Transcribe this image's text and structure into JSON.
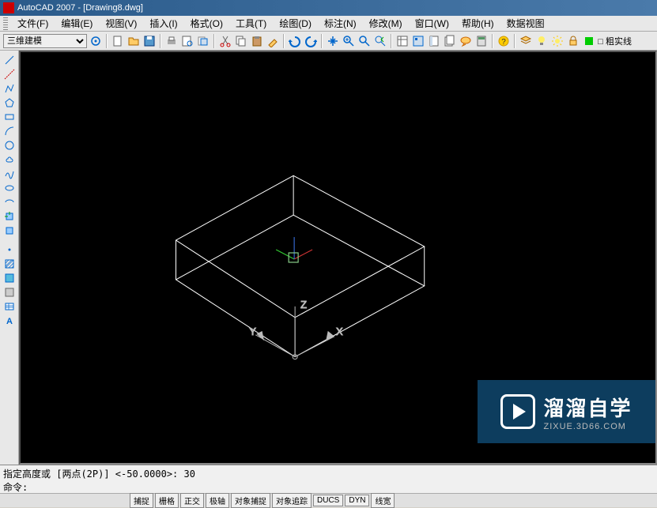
{
  "titlebar": {
    "title": "AutoCAD 2007 - [Drawing8.dwg]"
  },
  "menubar": {
    "items": [
      {
        "label": "文件(F)"
      },
      {
        "label": "编辑(E)"
      },
      {
        "label": "视图(V)"
      },
      {
        "label": "插入(I)"
      },
      {
        "label": "格式(O)"
      },
      {
        "label": "工具(T)"
      },
      {
        "label": "绘图(D)"
      },
      {
        "label": "标注(N)"
      },
      {
        "label": "修改(M)"
      },
      {
        "label": "窗口(W)"
      },
      {
        "label": "帮助(H)"
      },
      {
        "label": "数据视图"
      }
    ]
  },
  "toolbar": {
    "workspace_value": "三维建模",
    "layer_label": "□ 粗实线"
  },
  "canvas": {
    "axis_z": "Z",
    "axis_y": "Y",
    "axis_x": "X"
  },
  "watermark": {
    "title": "溜溜自学",
    "url": "ZIXUE.3D66.COM"
  },
  "command": {
    "line1": "指定高度或 [两点(2P)] <-50.0000>: 30",
    "line2": "命令:"
  },
  "statusbar": {
    "coords": "",
    "buttons": [
      {
        "label": "捕捉"
      },
      {
        "label": "栅格"
      },
      {
        "label": "正交"
      },
      {
        "label": "极轴"
      },
      {
        "label": "对象捕捉"
      },
      {
        "label": "对象追踪"
      },
      {
        "label": "DUCS"
      },
      {
        "label": "DYN"
      },
      {
        "label": "线宽"
      }
    ]
  }
}
